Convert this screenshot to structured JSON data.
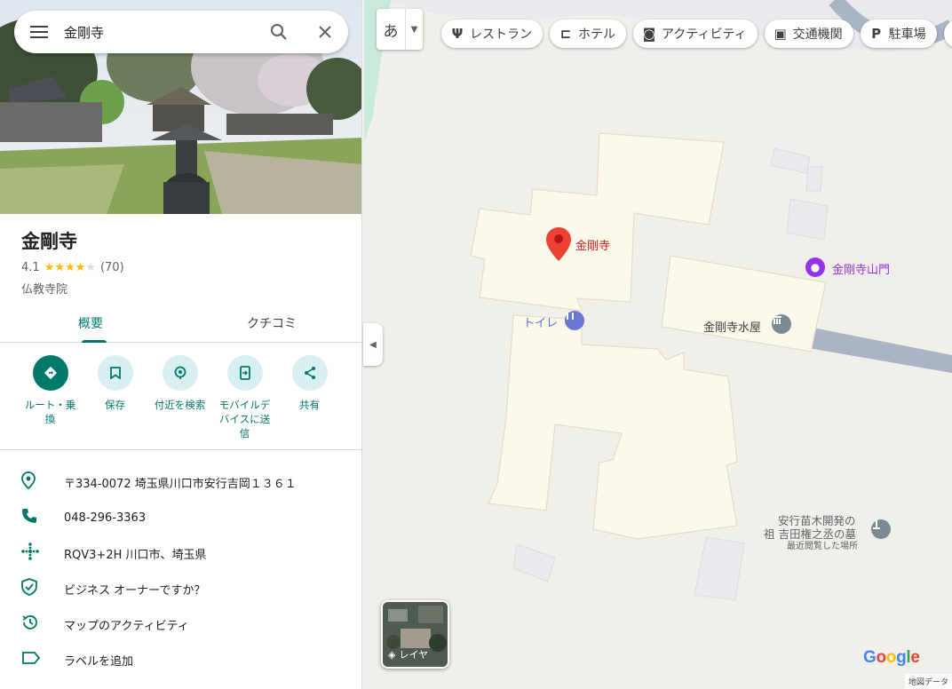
{
  "search": {
    "value": "金剛寺"
  },
  "place": {
    "title": "金剛寺",
    "rating": "4.1",
    "rating_value": 4.1,
    "review_count": "(70)",
    "category": "仏教寺院"
  },
  "tabs": [
    {
      "label": "概要",
      "active": true
    },
    {
      "label": "クチコミ",
      "active": false
    }
  ],
  "actions": [
    {
      "label": "ルート・乗換",
      "icon": "directions-icon"
    },
    {
      "label": "保存",
      "icon": "bookmark-icon"
    },
    {
      "label": "付近を検索",
      "icon": "nearby-search-icon"
    },
    {
      "label": "モバイルデバイスに送信",
      "icon": "send-to-phone-icon"
    },
    {
      "label": "共有",
      "icon": "share-icon"
    }
  ],
  "info": [
    {
      "text": "〒334-0072 埼玉県川口市安行吉岡１３６１",
      "icon": "location-pin-icon"
    },
    {
      "text": "048-296-3363",
      "icon": "phone-icon"
    },
    {
      "text": "RQV3+2H 川口市、埼玉県",
      "icon": "plus-code-icon"
    },
    {
      "text": "ビジネス オーナーですか？",
      "icon": "verified-shield-icon"
    },
    {
      "text": "マップのアクティビティ",
      "icon": "history-icon"
    },
    {
      "text": "ラベルを追加",
      "icon": "label-icon"
    }
  ],
  "map": {
    "lang_button": "あ",
    "chips": [
      {
        "label": "レストラン",
        "icon": "restaurant-icon"
      },
      {
        "label": "ホテル",
        "icon": "hotel-icon"
      },
      {
        "label": "アクティビティ",
        "icon": "camera-icon"
      },
      {
        "label": "交通機関",
        "icon": "transit-icon"
      },
      {
        "label": "駐車場",
        "icon": "parking-icon"
      },
      {
        "label": "",
        "icon": "more-icon"
      }
    ],
    "labels": {
      "main_pin": "金剛寺",
      "gate": "金剛寺山門",
      "toilet": "トイレ",
      "mizuya": "金剛寺水屋",
      "grave_line1": "安行苗木開発の",
      "grave_line2": "祖 吉田権之丞の墓",
      "recent": "最近閲覧した場所"
    },
    "layer_label": "レイヤ",
    "logo": "Google",
    "attribution": "地図データ"
  },
  "colors": {
    "accent": "#00796b",
    "building": "#fdf8ec",
    "pin": "#ea4335",
    "poi_purple": "#9334e6",
    "poi_gray": "#7b8a93"
  }
}
